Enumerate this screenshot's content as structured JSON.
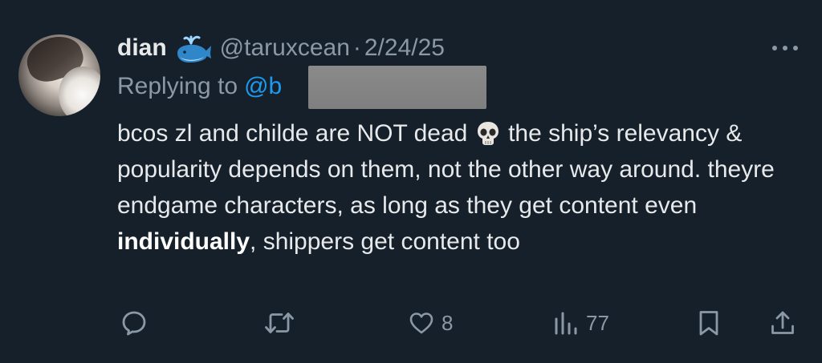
{
  "tweet": {
    "display_name": "dian",
    "handle": "@taruxcean",
    "separator": "·",
    "date": "2/24/25",
    "replying_prefix": "Replying to",
    "replying_handle_visible": "@b",
    "body": {
      "part1": "bcos zl and childe are NOT dead",
      "part2": " the ship’s relevancy & popularity depends on them, not the other way around. theyre endgame characters, as long as they get content even ",
      "emphasis": "individually",
      "part3": ", shippers get content too"
    }
  },
  "actions": {
    "reply_icon": "reply-icon",
    "retweet_icon": "retweet-icon",
    "like_icon": "heart-icon",
    "like_count": "8",
    "views_icon": "views-bar-chart-icon",
    "views_count": "77",
    "bookmark_icon": "bookmark-icon",
    "share_icon": "share-icon"
  },
  "colors": {
    "background": "#15202b",
    "text_primary": "#e7e9ea",
    "text_secondary": "#8b98a5",
    "link": "#1d9bf0",
    "redaction": "#808080"
  }
}
